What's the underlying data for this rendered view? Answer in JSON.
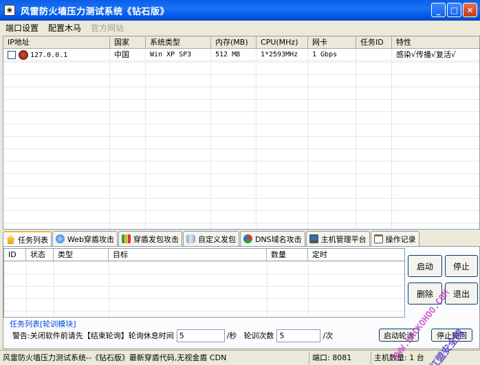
{
  "window": {
    "title": "风雷防火墙压力测试系统《钻石版》",
    "app_icon": "❀"
  },
  "menu": [
    {
      "label": "端口设置",
      "enabled": true
    },
    {
      "label": "配置木马",
      "enabled": true
    },
    {
      "label": "官方网站",
      "enabled": false
    }
  ],
  "hosts": {
    "columns": [
      "IP地址",
      "国家",
      "系统类型",
      "内存(MB)",
      "CPU(MHz)",
      "网卡",
      "任务ID",
      "特性"
    ],
    "rows": [
      {
        "ip": "127.0.0.1",
        "country": "中国",
        "os": "Win XP SP3",
        "memory": "512 MB",
        "cpu": "1*2593MHz",
        "nic": "1 Gbps",
        "task_id": "",
        "features": "感染√传播√复活√"
      }
    ]
  },
  "tabs": [
    {
      "label": "任务列表",
      "icon": "home-icon",
      "active": true
    },
    {
      "label": "Web穿盾攻击",
      "icon": "globe-icon",
      "active": false
    },
    {
      "label": "穿盾发包攻击",
      "icon": "bar-chart-icon",
      "active": false
    },
    {
      "label": "自定义发包",
      "icon": "cylinder-icon",
      "active": false
    },
    {
      "label": "DNS域名攻击",
      "icon": "pie-chart-icon",
      "active": false
    },
    {
      "label": "主机管理平台",
      "icon": "monitor-icon",
      "active": false
    },
    {
      "label": "操作记录",
      "icon": "clipboard-icon",
      "active": false
    }
  ],
  "tasks": {
    "columns": [
      "ID",
      "状态",
      "类型",
      "目标",
      "数量",
      "定时"
    ],
    "rows": []
  },
  "buttons": {
    "start": "启动",
    "stop": "停止",
    "delete": "删除",
    "exit": "退出"
  },
  "polling": {
    "group_title": "任务列表[轮训模块]",
    "warning": "警告:关闭软件前请先【结束轮询】轮询休息时间",
    "rest_value": "5",
    "rest_unit": "/秒",
    "count_label": "轮训次数",
    "count_value": "5",
    "count_unit": "/次",
    "start_button": "启动轮询",
    "stop_button": "停止轮回"
  },
  "status": {
    "message": "风雷防火墙压力测试系统--《钻石版》最新穿盾代码,无视金盾 CDN",
    "port": "端口: 8081",
    "host_count": "主机数量: 1 台"
  },
  "watermark": {
    "line1": "WWW.HACKOHOO.COM",
    "line2": "红盟安全网"
  }
}
